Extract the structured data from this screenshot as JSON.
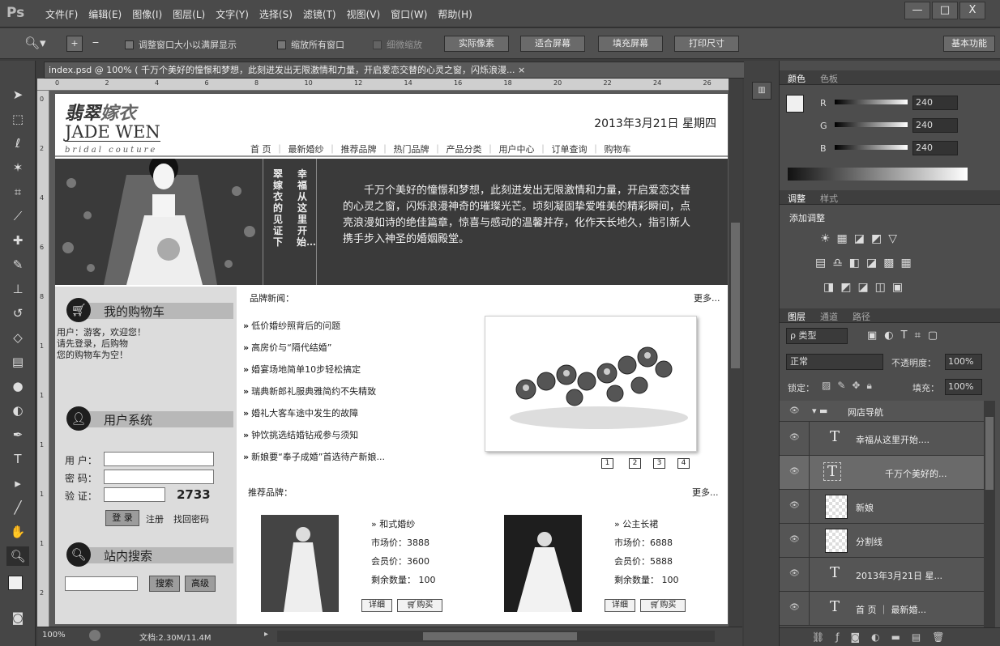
{
  "app": {
    "logo": "Ps",
    "menus": [
      "文件(F)",
      "编辑(E)",
      "图像(I)",
      "图层(L)",
      "文字(Y)",
      "选择(S)",
      "滤镜(T)",
      "视图(V)",
      "窗口(W)",
      "帮助(H)"
    ],
    "window_buttons": [
      "—",
      "□",
      "X"
    ]
  },
  "options": {
    "chk1": "调整窗口大小以满屏显示",
    "chk2": "缩放所有窗口",
    "chk3": "细微缩放",
    "btn1": "实际像素",
    "btn2": "适合屏幕",
    "btn3": "填充屏幕",
    "btn4": "打印尺寸",
    "workspace": "基本功能"
  },
  "doc": {
    "tab": "index.psd @ 100% (    千万个美好的憧憬和梦想，此刻迸发出无限激情和力量，开启爱恋交替的心灵之窗，闪烁浪漫...",
    "zoom": "100%",
    "status": "文档:2.30M/11.4M"
  },
  "ruler_h": [
    "0",
    "2",
    "4",
    "6",
    "8",
    "10",
    "12",
    "14",
    "16",
    "18",
    "20",
    "22",
    "24",
    "26"
  ],
  "ruler_v": [
    "0",
    "2",
    "4",
    "6",
    "8",
    "1",
    "1",
    "1",
    "1",
    "1",
    "2"
  ],
  "page": {
    "logo_cn1": "翡翠",
    "logo_cn2": "嫁衣",
    "logo_en": "JADE WEN",
    "logo_sub": "bridal couture",
    "date": "2013年3月21日  星期四",
    "nav": [
      "首  页",
      "最新婚纱",
      "推荐品牌",
      "热门品牌",
      "产品分类",
      "用户中心",
      "订单查询",
      "购物车"
    ],
    "vert1": "幸福从这里开始…",
    "vert2": "翠嫁衣的见证下",
    "banner_text": "千万个美好的憧憬和梦想，此刻迸发出无限激情和力量，开启爱恋交替的心灵之窗，闪烁浪漫神奇的璀璨光芒。顷刻凝固挚爱唯美的精彩瞬间，点亮浪漫如诗的绝佳篇章，惊喜与感动的温馨并存，化作天长地久，指引新人携手步入神圣的婚姻殿堂。",
    "cart_title": "我的购物车",
    "cart_lines": [
      "用户：游客，欢迎您！",
      "请先登录，后购物",
      "您的购物车为空！"
    ],
    "user_title": "用户系统",
    "user_label": "用 户：",
    "pwd_label": "密 码：",
    "code_label": "验 证：",
    "captcha": "2733",
    "login_btn": "登 录",
    "register": "注册",
    "findpwd": "找回密码",
    "search_title": "站内搜索",
    "search_btn": "搜索",
    "adv_btn": "高级",
    "news_title": "品牌新闻：",
    "more": "更多...",
    "news": [
      "低价婚纱照背后的问题",
      "高房价与“隔代结婚”",
      "婚宴场地简单10步轻松搞定",
      "瑞典新郎礼服典雅简约不失精致",
      "婚礼大客车途中发生的故障",
      "钟饮挑选结婚钻戒参与须知",
      "新娘要“奉子成婚”首选待产新娘..."
    ],
    "pages": [
      "1",
      "2",
      "3",
      "4"
    ],
    "rec_title": "推荐品牌：",
    "products": [
      {
        "name": "和式婚纱",
        "market": "市场价：3888",
        "member": "会员价：3600",
        "stock_label": "剩余数量：",
        "stock": "100",
        "detail": "详细",
        "buy": "购买"
      },
      {
        "name": "公主长裙",
        "market": "市场价：6888",
        "member": "会员价：5888",
        "stock_label": "剩余数量：",
        "stock": "100",
        "detail": "详细",
        "buy": "购买"
      }
    ]
  },
  "color_panel": {
    "tab1": "颜色",
    "tab2": "色板",
    "r_label": "R",
    "g_label": "G",
    "b_label": "B",
    "r": "240",
    "g": "240",
    "b": "240"
  },
  "adjust_panel": {
    "tab1": "调整",
    "tab2": "样式",
    "title": "添加调整"
  },
  "layers_panel": {
    "tab1": "图层",
    "tab2": "通道",
    "tab3": "路径",
    "kind": "ρ 类型",
    "blend": "正常",
    "opacity_label": "不透明度：",
    "opacity": "100%",
    "lock_label": "锁定：",
    "fill_label": "填充：",
    "fill": "100%",
    "layers": [
      "网店导航",
      "幸福从这里开始....",
      "千万个美好的...",
      "新娘",
      "分割线",
      "2013年3月21日 星...",
      "首  页 ｜ 最新婚..."
    ]
  },
  "accent": "#3a3a3a"
}
